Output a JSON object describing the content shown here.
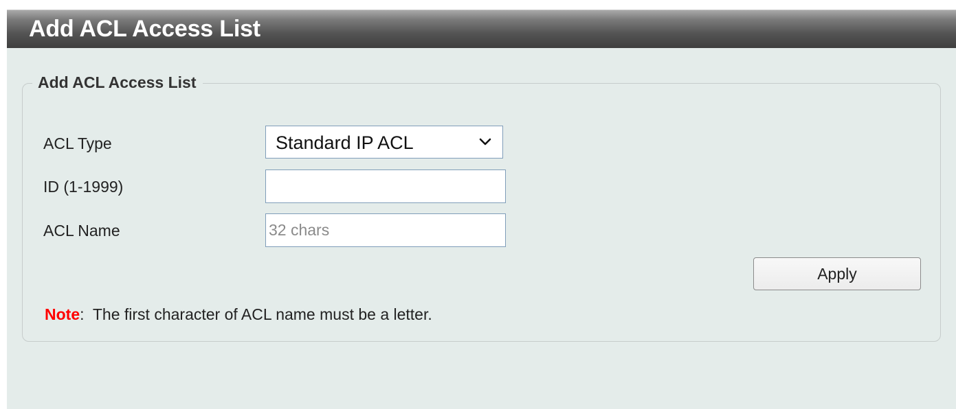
{
  "header": {
    "title": "Add ACL Access List"
  },
  "form": {
    "legend": "Add ACL Access List",
    "acl_type": {
      "label": "ACL Type",
      "selected": "Standard IP ACL"
    },
    "id": {
      "label": "ID (1-1999)",
      "value": "",
      "placeholder": ""
    },
    "acl_name": {
      "label": "ACL Name",
      "value": "",
      "placeholder": "32 chars"
    },
    "apply_label": "Apply",
    "note": {
      "label": "Note",
      "separator": ":",
      "text": "  The first character of ACL name must be a letter."
    }
  },
  "colors": {
    "page_background": "#e4ecea",
    "note_label": "#ff0000",
    "title_bar": "#555555"
  },
  "icons": {
    "acl_type_dropdown": "chevron-down-icon"
  }
}
